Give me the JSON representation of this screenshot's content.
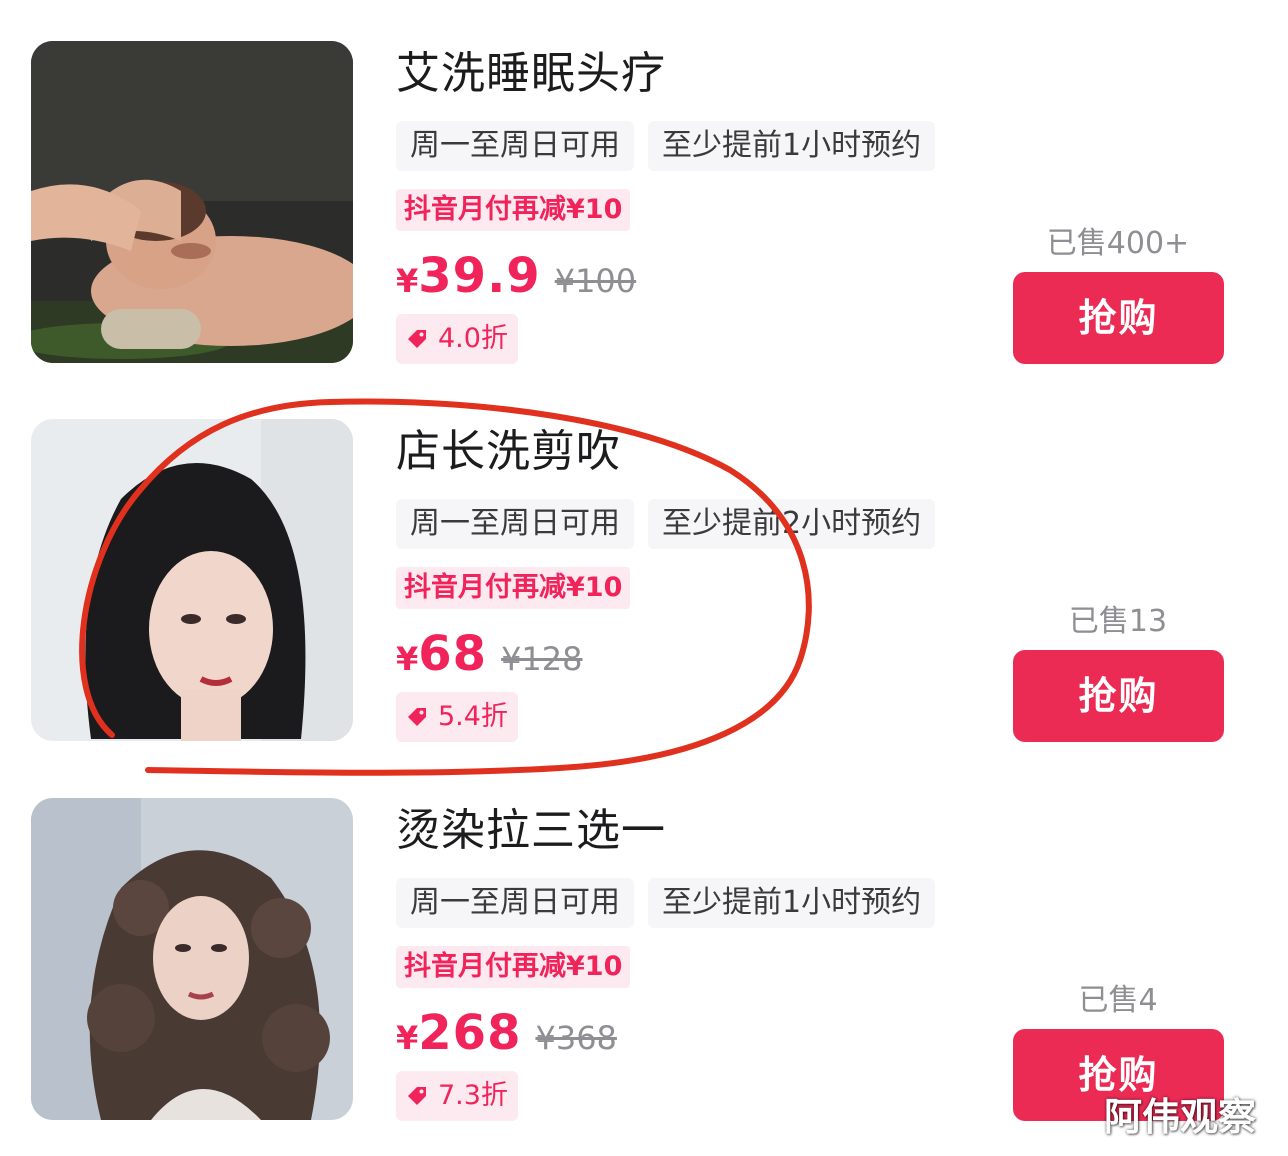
{
  "colors": {
    "accent": "#f0245b",
    "button": "#ec2b55",
    "annotation": "#e0301e"
  },
  "items": [
    {
      "title": "艾洗睡眠头疗",
      "tags": [
        "周一至周日可用",
        "至少提前1小时预约"
      ],
      "promo": "抖音月付再减¥10",
      "price_symbol": "¥",
      "price": "39.9",
      "original_price": "¥100",
      "discount": "4.0折",
      "sold": "已售400+",
      "buy_label": "抢购",
      "image": "spa-head-massage-photo"
    },
    {
      "title": "店长洗剪吹",
      "tags": [
        "周一至周日可用",
        "至少提前2小时预约"
      ],
      "promo": "抖音月付再减¥10",
      "price_symbol": "¥",
      "price": "68",
      "original_price": "¥128",
      "discount": "5.4折",
      "sold": "已售13",
      "buy_label": "抢购",
      "image": "woman-straight-hair-photo"
    },
    {
      "title": "烫染拉三选一",
      "tags": [
        "周一至周日可用",
        "至少提前1小时预约"
      ],
      "promo": "抖音月付再减¥10",
      "price_symbol": "¥",
      "price": "268",
      "original_price": "¥368",
      "discount": "7.3折",
      "sold": "已售4",
      "buy_label": "抢购",
      "image": "woman-curly-hair-photo"
    }
  ],
  "watermark": "阿伟观察"
}
